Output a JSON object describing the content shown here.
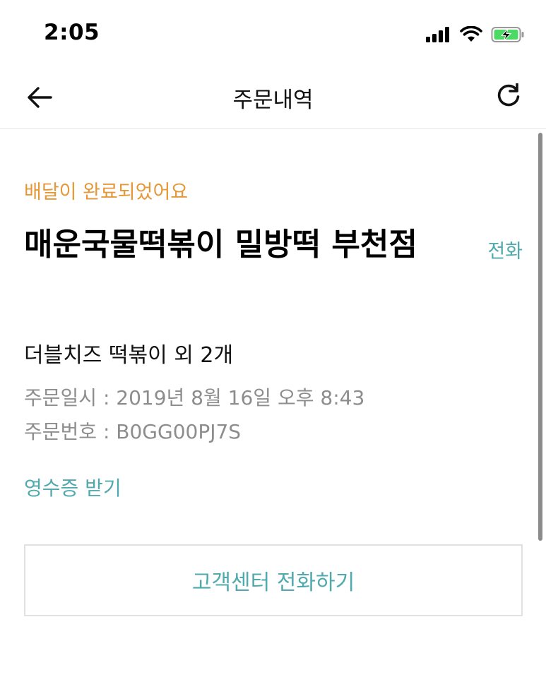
{
  "status_bar": {
    "time": "2:05"
  },
  "nav": {
    "title": "주문내역",
    "back_icon": "arrow-left-icon",
    "refresh_icon": "refresh-icon"
  },
  "order": {
    "status": "배달이 완료되었어요",
    "store_name": "매운국물떡볶이 밀방떡 부천점",
    "call_label": "전화",
    "menu_summary": "더블치즈 떡볶이 외 2개",
    "order_date": "주문일시 : 2019년 8월 16일 오후 8:43",
    "order_number": "주문번호 : B0GG00PJ7S",
    "receipt_label": "영수증 받기"
  },
  "customer_service": {
    "button_label": "고객센터 전화하기"
  },
  "colors": {
    "status_orange": "#e69838",
    "link_teal": "#4fa9ad",
    "muted_gray": "#8d8d8d",
    "battery_green": "#4cd964"
  }
}
